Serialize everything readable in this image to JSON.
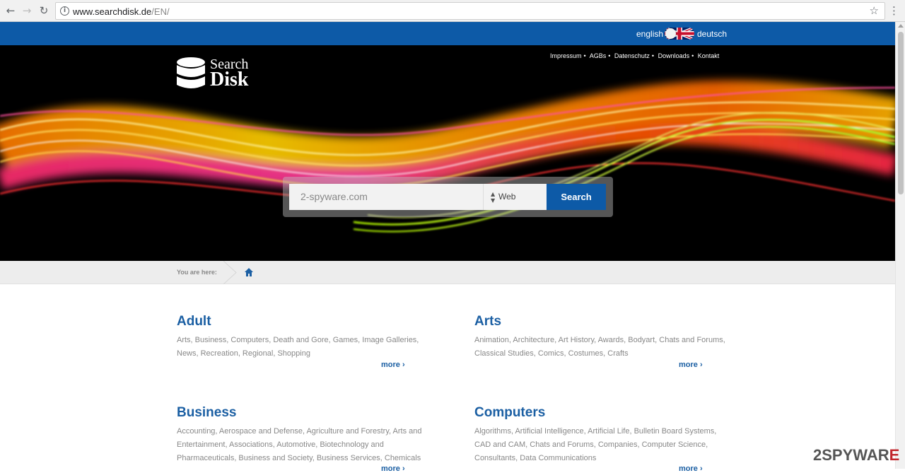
{
  "browser": {
    "url_host": "www.searchdisk.de",
    "url_path": "/EN/"
  },
  "lang": {
    "english": "english",
    "deutsch": "deutsch"
  },
  "logo": {
    "line1": "Search",
    "line2": "Disk"
  },
  "toplinks": [
    "Impressum",
    "AGBs",
    "Datenschutz",
    "Downloads",
    "Kontakt"
  ],
  "search": {
    "value": "2-spyware.com",
    "type": "Web",
    "button": "Search"
  },
  "breadcrumb": {
    "label": "You are here:"
  },
  "categories": [
    {
      "title": "Adult",
      "desc": "Arts, Business, Computers, Death and Gore, Games, Image Galleries, News, Recreation, Regional, Shopping",
      "more": "more"
    },
    {
      "title": "Arts",
      "desc": "Animation, Architecture, Art History, Awards, Bodyart, Chats and Forums, Classical Studies, Comics, Costumes, Crafts",
      "more": "more"
    },
    {
      "title": "Business",
      "desc": "Accounting, Aerospace and Defense, Agriculture and Forestry, Arts and Entertainment, Associations, Automotive, Biotechnology and Pharmaceuticals, Business and Society, Business Services, Chemicals",
      "more": "more"
    },
    {
      "title": "Computers",
      "desc": "Algorithms, Artificial Intelligence, Artificial Life, Bulletin Board Systems, CAD and CAM, Chats and Forums, Companies, Computer Science, Consultants, Data Communications",
      "more": "more"
    }
  ],
  "watermark": {
    "prefix": "2",
    "mid": "SPYWAR",
    "suffix": "E"
  },
  "colors": {
    "brand_blue": "#0d5aa7",
    "link_blue": "#1b5fa3"
  }
}
